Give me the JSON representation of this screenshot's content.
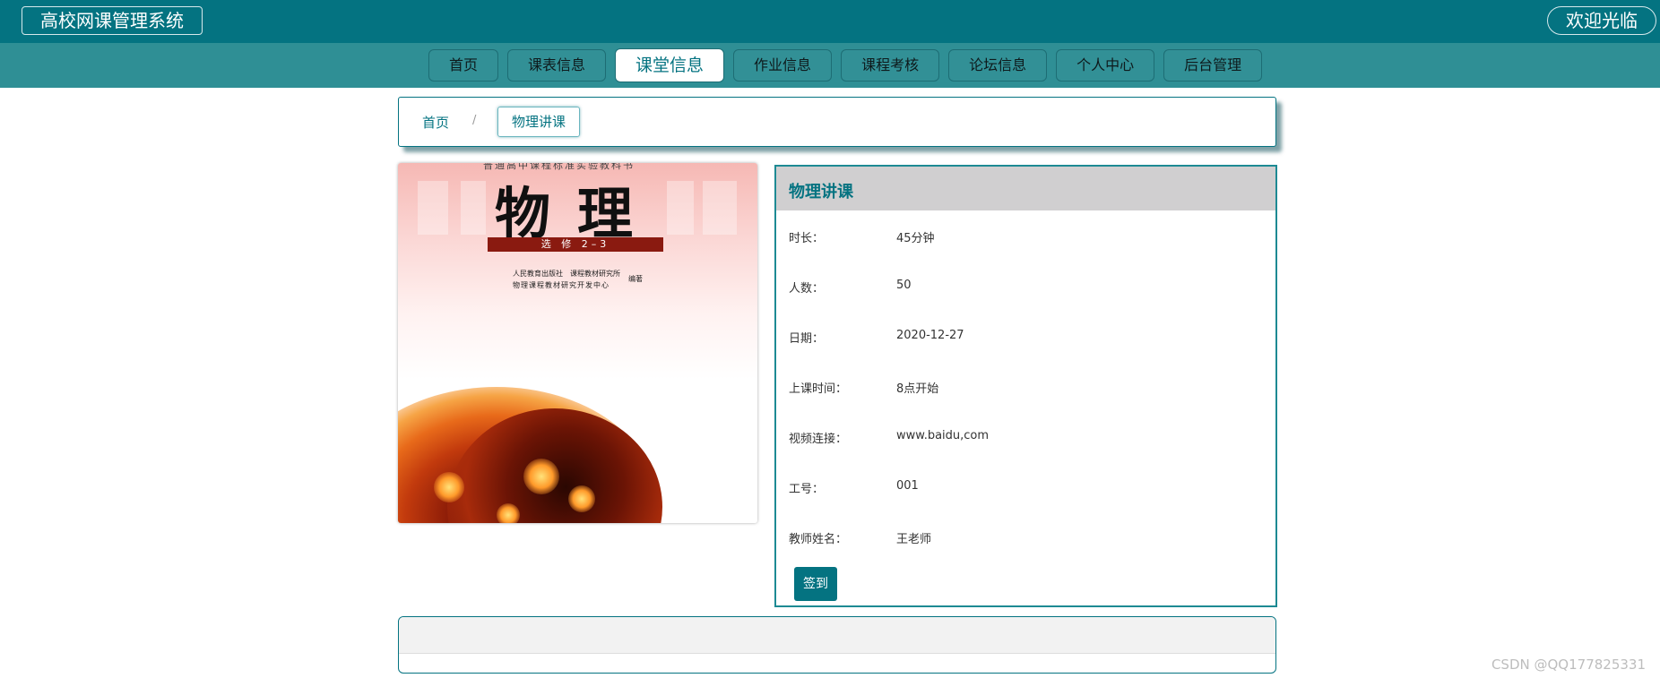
{
  "header": {
    "site_title": "高校网课管理系统",
    "welcome": "欢迎光临"
  },
  "nav": {
    "items": [
      {
        "label": "首页"
      },
      {
        "label": "课表信息"
      },
      {
        "label": "课堂信息",
        "active": true
      },
      {
        "label": "作业信息"
      },
      {
        "label": "课程考核"
      },
      {
        "label": "论坛信息"
      },
      {
        "label": "个人中心"
      },
      {
        "label": "后台管理"
      }
    ]
  },
  "breadcrumb": {
    "home": "首页",
    "separator": "/",
    "current": "物理讲课"
  },
  "cover": {
    "top_text": "普通高中课程标准实验教科书",
    "title": "物理",
    "band": "选 修 2–3",
    "publisher_line1": "人民教育出版社　课程教材研究所",
    "publisher_line2": "物理课程教材研究开发中心",
    "publisher_role": "编著"
  },
  "detail": {
    "title": "物理讲课",
    "fields": [
      {
        "label": "时长：",
        "value": "45分钟"
      },
      {
        "label": "人数：",
        "value": "50"
      },
      {
        "label": "日期：",
        "value": "2020-12-27"
      },
      {
        "label": "上课时间：",
        "value": "8点开始"
      },
      {
        "label": "视频连接：",
        "value": "www.baidu,com"
      },
      {
        "label": "工号：",
        "value": "001"
      },
      {
        "label": "教师姓名：",
        "value": "王老师"
      }
    ],
    "checkin_label": "签到"
  },
  "watermark": "CSDN @QQ177825331",
  "colors": {
    "primary": "#047381",
    "nav_bg": "#2f8f95",
    "header_bg": "#d0cfd0"
  }
}
